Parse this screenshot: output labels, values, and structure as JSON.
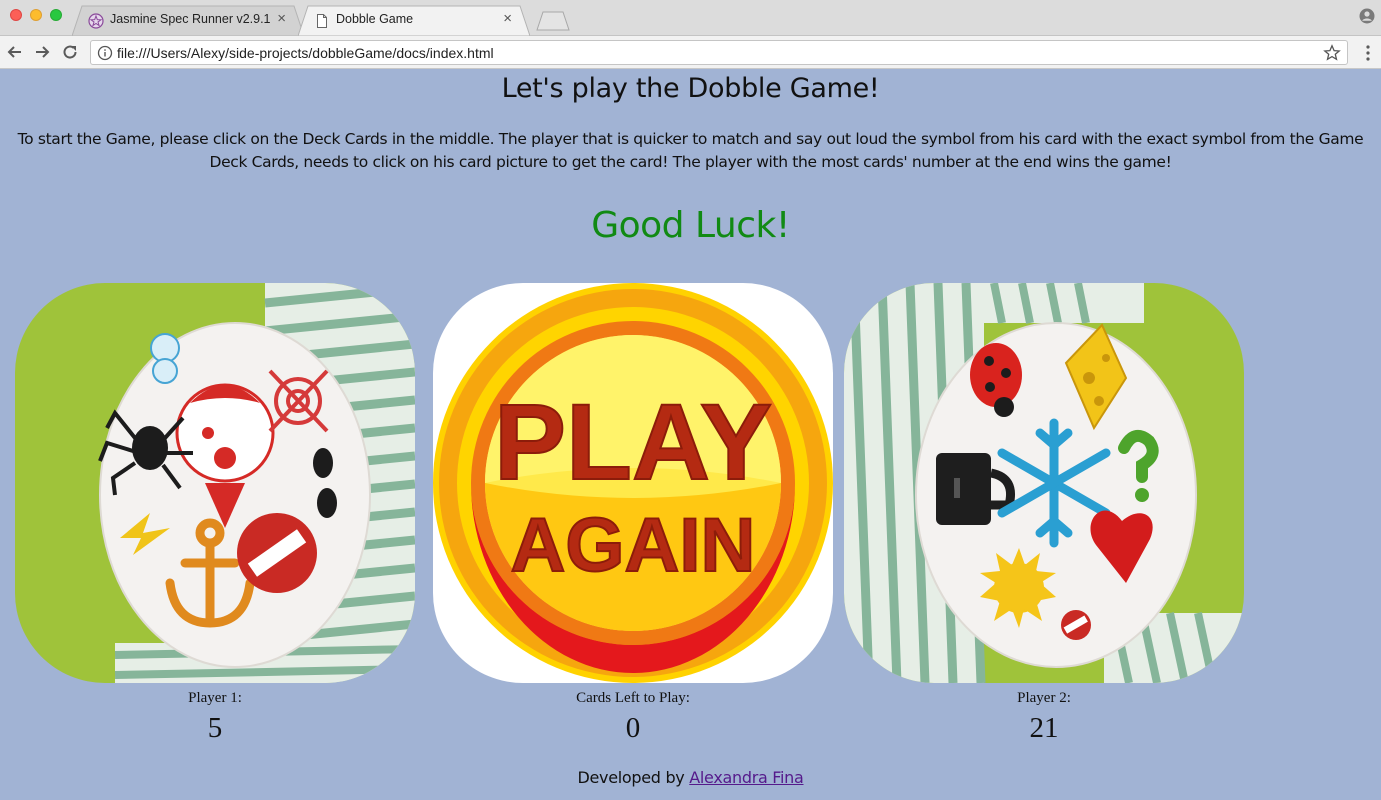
{
  "browser": {
    "tabs": [
      {
        "title": "Jasmine Spec Runner v2.9.1",
        "close": "×",
        "icon": "jasmine-icon"
      },
      {
        "title": "Dobble Game",
        "close": "×",
        "icon": "document-icon"
      }
    ],
    "url": "file:///Users/Alexy/side-projects/dobbleGame/docs/index.html"
  },
  "page": {
    "title": "Let's play the Dobble Game!",
    "instructions": "To start the Game, please click on the Deck Cards in the middle. The player that is quicker to match and say out loud the symbol from his card with the exact symbol from the Game Deck Cards, needs to click on his card picture to get the card! The player with the most cards' number at the end wins the game!",
    "good_luck": "Good Luck!",
    "good_luck_color": "#118a14"
  },
  "deck": {
    "button_line1": "PLAY",
    "button_line2": "AGAIN",
    "label": "Cards Left to Play:",
    "count": "0"
  },
  "player1": {
    "label": "Player 1:",
    "score": "5"
  },
  "player2": {
    "label": "Player 2:",
    "score": "21"
  },
  "footer": {
    "prefix": "Developed by",
    "author": "Alexandra Fina"
  }
}
